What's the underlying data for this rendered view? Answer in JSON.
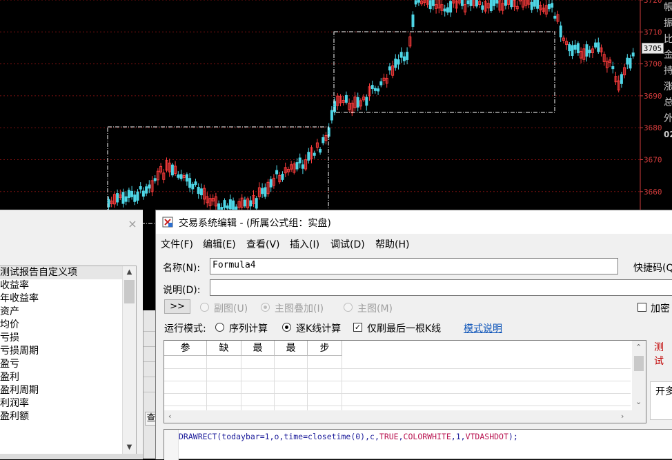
{
  "chart": {
    "axis_ticks": [
      "3720",
      "3710",
      "3700",
      "3690",
      "3680",
      "3670",
      "3660"
    ],
    "current_price": "3705",
    "colors": {
      "up": "#ff3c3c",
      "down": "#4ed6e6",
      "grid": "#7a1010",
      "rect": "#ffffff",
      "axis": "#d23b3b"
    }
  },
  "right_panel": {
    "chars": [
      "帳",
      "振",
      "比",
      "金",
      "持",
      "涨",
      "总",
      "外",
      "02"
    ]
  },
  "left_dialog": {
    "close_label": "×",
    "items": [
      "测试报告自定义项",
      "收益率",
      "年收益率",
      "资产",
      "均价",
      "亏损",
      "亏损周期",
      "盈亏",
      "盈利",
      "盈利周期",
      "利润率",
      "盈利额"
    ],
    "scroll_up": "▲",
    "scroll_down": "▼"
  },
  "mid_strip": {
    "button_label": "查"
  },
  "editor": {
    "title": "交易系统编辑 - (所属公式组：实盘)",
    "menu": [
      "文件(F)",
      "编辑(E)",
      "查看(V)",
      "插入(I)",
      "调试(D)",
      "帮助(H)"
    ],
    "name_label": "名称(N):",
    "name_value": "Formula4",
    "shortcut_label": "快捷码(Q",
    "desc_label": "说明(D):",
    "desc_value": "",
    "expand_label": ">>",
    "chart_options": [
      "副图(U)",
      "主图叠加(I)",
      "主图(M)"
    ],
    "encrypt_label": "加密",
    "run_mode_label": "运行模式:",
    "run_modes": [
      "序列计算",
      "逐K线计算"
    ],
    "last_bar_label": "仅刷最后一根K线",
    "mode_help_link": "模式说明",
    "param_headers": [
      "参",
      "缺",
      "最",
      "最",
      "步"
    ],
    "right_red_text": "测试",
    "right_box_text": "开多",
    "code": {
      "t1": "DRAWRECT",
      "t2": "(",
      "t3": "todaybar",
      "t4": "=1,",
      "t5": "o",
      "t6": ",",
      "t7": "time",
      "t8": "=",
      "t9": "closetime",
      "t10": "(0),",
      "t11": "c",
      "t12": ",",
      "t13": "TRUE",
      "t14": ",",
      "t15": "COLORWHITE",
      "t16": ",1,",
      "t17": "VTDASHDOT",
      "t18": ");"
    }
  }
}
